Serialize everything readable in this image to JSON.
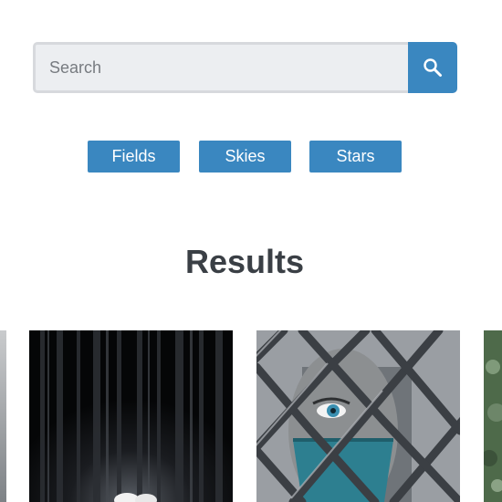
{
  "search": {
    "placeholder": "Search",
    "value": "",
    "button_icon": "search-icon"
  },
  "filters": [
    {
      "label": "Fields"
    },
    {
      "label": "Skies"
    },
    {
      "label": "Stars"
    }
  ],
  "results": {
    "title": "Results",
    "images": [
      {
        "name": "partial-image-left"
      },
      {
        "name": "dark-forest-image"
      },
      {
        "name": "eye-behind-fence-image"
      },
      {
        "name": "partial-image-right"
      }
    ]
  },
  "colors": {
    "accent": "#3a87c0",
    "input_bg": "#eceef1",
    "input_border": "#d7d9dd",
    "heading": "#3a3f45"
  }
}
